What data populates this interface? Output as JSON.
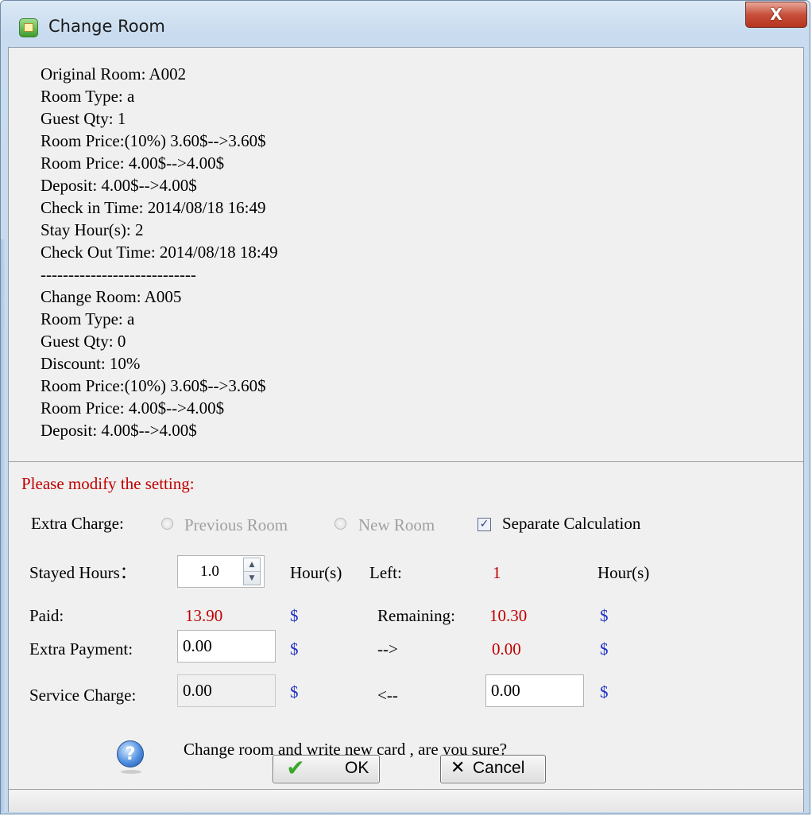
{
  "window": {
    "title": "Change Room",
    "close_label": "X"
  },
  "info": {
    "lines": [
      "Original Room: A002",
      "Room Type: a",
      "Guest Qty: 1",
      "Room Price:(10%) 3.60$-->3.60$",
      "Room Price: 4.00$-->4.00$",
      "Deposit: 4.00$-->4.00$",
      "Check in Time: 2014/08/18 16:49",
      "Stay Hour(s): 2",
      "Check Out Time: 2014/08/18 18:49",
      "----------------------------",
      "Change Room: A005",
      "Room Type: a",
      "Guest Qty: 0",
      "Discount: 10%",
      "Room Price:(10%) 3.60$-->3.60$",
      "Room Price: 4.00$-->4.00$",
      "Deposit: 4.00$-->4.00$"
    ]
  },
  "settings": {
    "prompt": "Please modify the setting:",
    "extra_charge_label": "Extra Charge:",
    "previous_room_label": "Previous Room",
    "new_room_label": "New Room",
    "separate_calc_label": "Separate Calculation",
    "separate_calc_checked": true,
    "stayed_hours_label": "Stayed Hours：",
    "stayed_hours_value": "1.0",
    "hours_unit": "Hour(s)",
    "left_label": "Left:",
    "left_value": "1",
    "left_unit": "Hour(s)",
    "paid_label": "Paid:",
    "paid_value": "13.90",
    "currency": "$",
    "remaining_label": "Remaining:",
    "remaining_value": "10.30",
    "extra_payment_label": "Extra Payment:",
    "extra_payment_value": "0.00",
    "arrow_right": "-->",
    "arrow_right_value": "0.00",
    "service_charge_label": "Service Charge:",
    "service_charge_value": "0.00",
    "arrow_left": "<--",
    "arrow_left_value": "0.00"
  },
  "confirm": {
    "icon": "question-icon",
    "text": "Change room and write new card , are you sure?"
  },
  "buttons": {
    "ok_label": "OK",
    "cancel_label": "Cancel"
  },
  "colors": {
    "accent_red": "#c00000",
    "accent_blue": "#1f2fc8"
  }
}
